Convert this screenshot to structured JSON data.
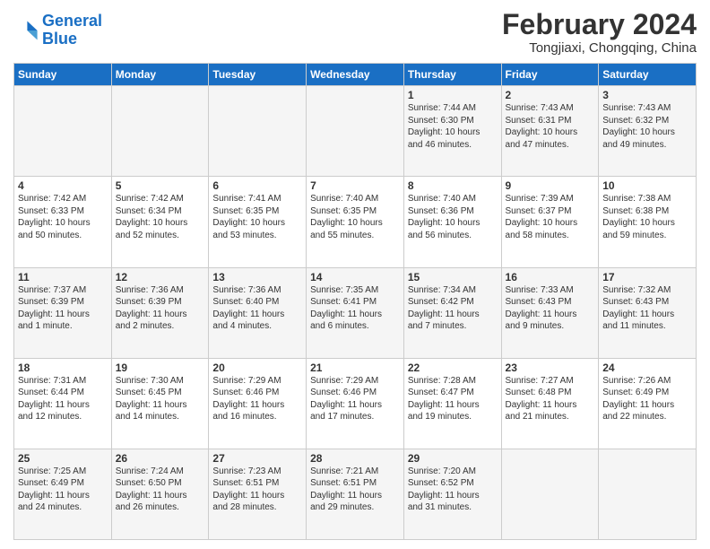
{
  "logo": {
    "line1": "General",
    "line2": "Blue"
  },
  "header": {
    "month": "February 2024",
    "location": "Tongjiaxi, Chongqing, China"
  },
  "days_of_week": [
    "Sunday",
    "Monday",
    "Tuesday",
    "Wednesday",
    "Thursday",
    "Friday",
    "Saturday"
  ],
  "weeks": [
    [
      {
        "day": "",
        "info": ""
      },
      {
        "day": "",
        "info": ""
      },
      {
        "day": "",
        "info": ""
      },
      {
        "day": "",
        "info": ""
      },
      {
        "day": "1",
        "info": "Sunrise: 7:44 AM\nSunset: 6:30 PM\nDaylight: 10 hours\nand 46 minutes."
      },
      {
        "day": "2",
        "info": "Sunrise: 7:43 AM\nSunset: 6:31 PM\nDaylight: 10 hours\nand 47 minutes."
      },
      {
        "day": "3",
        "info": "Sunrise: 7:43 AM\nSunset: 6:32 PM\nDaylight: 10 hours\nand 49 minutes."
      }
    ],
    [
      {
        "day": "4",
        "info": "Sunrise: 7:42 AM\nSunset: 6:33 PM\nDaylight: 10 hours\nand 50 minutes."
      },
      {
        "day": "5",
        "info": "Sunrise: 7:42 AM\nSunset: 6:34 PM\nDaylight: 10 hours\nand 52 minutes."
      },
      {
        "day": "6",
        "info": "Sunrise: 7:41 AM\nSunset: 6:35 PM\nDaylight: 10 hours\nand 53 minutes."
      },
      {
        "day": "7",
        "info": "Sunrise: 7:40 AM\nSunset: 6:35 PM\nDaylight: 10 hours\nand 55 minutes."
      },
      {
        "day": "8",
        "info": "Sunrise: 7:40 AM\nSunset: 6:36 PM\nDaylight: 10 hours\nand 56 minutes."
      },
      {
        "day": "9",
        "info": "Sunrise: 7:39 AM\nSunset: 6:37 PM\nDaylight: 10 hours\nand 58 minutes."
      },
      {
        "day": "10",
        "info": "Sunrise: 7:38 AM\nSunset: 6:38 PM\nDaylight: 10 hours\nand 59 minutes."
      }
    ],
    [
      {
        "day": "11",
        "info": "Sunrise: 7:37 AM\nSunset: 6:39 PM\nDaylight: 11 hours\nand 1 minute."
      },
      {
        "day": "12",
        "info": "Sunrise: 7:36 AM\nSunset: 6:39 PM\nDaylight: 11 hours\nand 2 minutes."
      },
      {
        "day": "13",
        "info": "Sunrise: 7:36 AM\nSunset: 6:40 PM\nDaylight: 11 hours\nand 4 minutes."
      },
      {
        "day": "14",
        "info": "Sunrise: 7:35 AM\nSunset: 6:41 PM\nDaylight: 11 hours\nand 6 minutes."
      },
      {
        "day": "15",
        "info": "Sunrise: 7:34 AM\nSunset: 6:42 PM\nDaylight: 11 hours\nand 7 minutes."
      },
      {
        "day": "16",
        "info": "Sunrise: 7:33 AM\nSunset: 6:43 PM\nDaylight: 11 hours\nand 9 minutes."
      },
      {
        "day": "17",
        "info": "Sunrise: 7:32 AM\nSunset: 6:43 PM\nDaylight: 11 hours\nand 11 minutes."
      }
    ],
    [
      {
        "day": "18",
        "info": "Sunrise: 7:31 AM\nSunset: 6:44 PM\nDaylight: 11 hours\nand 12 minutes."
      },
      {
        "day": "19",
        "info": "Sunrise: 7:30 AM\nSunset: 6:45 PM\nDaylight: 11 hours\nand 14 minutes."
      },
      {
        "day": "20",
        "info": "Sunrise: 7:29 AM\nSunset: 6:46 PM\nDaylight: 11 hours\nand 16 minutes."
      },
      {
        "day": "21",
        "info": "Sunrise: 7:29 AM\nSunset: 6:46 PM\nDaylight: 11 hours\nand 17 minutes."
      },
      {
        "day": "22",
        "info": "Sunrise: 7:28 AM\nSunset: 6:47 PM\nDaylight: 11 hours\nand 19 minutes."
      },
      {
        "day": "23",
        "info": "Sunrise: 7:27 AM\nSunset: 6:48 PM\nDaylight: 11 hours\nand 21 minutes."
      },
      {
        "day": "24",
        "info": "Sunrise: 7:26 AM\nSunset: 6:49 PM\nDaylight: 11 hours\nand 22 minutes."
      }
    ],
    [
      {
        "day": "25",
        "info": "Sunrise: 7:25 AM\nSunset: 6:49 PM\nDaylight: 11 hours\nand 24 minutes."
      },
      {
        "day": "26",
        "info": "Sunrise: 7:24 AM\nSunset: 6:50 PM\nDaylight: 11 hours\nand 26 minutes."
      },
      {
        "day": "27",
        "info": "Sunrise: 7:23 AM\nSunset: 6:51 PM\nDaylight: 11 hours\nand 28 minutes."
      },
      {
        "day": "28",
        "info": "Sunrise: 7:21 AM\nSunset: 6:51 PM\nDaylight: 11 hours\nand 29 minutes."
      },
      {
        "day": "29",
        "info": "Sunrise: 7:20 AM\nSunset: 6:52 PM\nDaylight: 11 hours\nand 31 minutes."
      },
      {
        "day": "",
        "info": ""
      },
      {
        "day": "",
        "info": ""
      }
    ]
  ]
}
